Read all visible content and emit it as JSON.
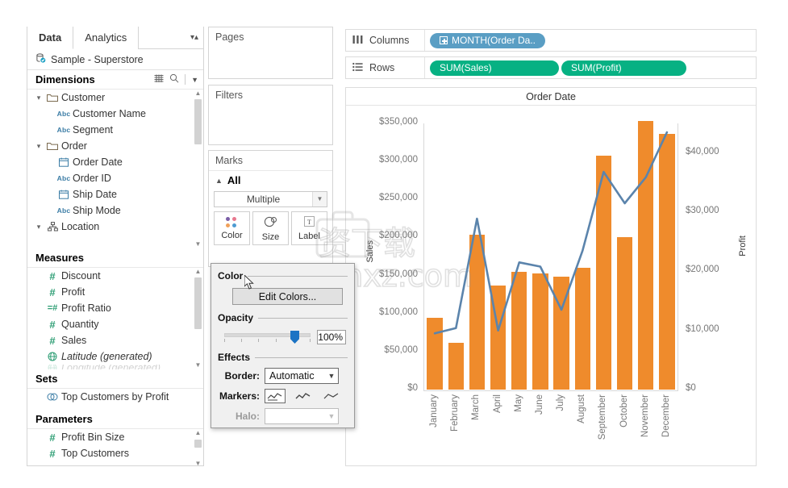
{
  "data_pane": {
    "tabs": [
      {
        "label": "Data",
        "active": true
      },
      {
        "label": "Analytics",
        "active": false
      }
    ],
    "tab_caret_icon": "updown-caret-icon",
    "datasource": {
      "name": "Sample - Superstore",
      "icon": "database-icon"
    },
    "dimensions": {
      "title": "Dimensions",
      "icons": [
        "grid-icon",
        "search-icon",
        "chevron-down-icon"
      ],
      "items": [
        {
          "label": "Customer",
          "type": "folder",
          "depth": 0,
          "expanded": true
        },
        {
          "label": "Customer Name",
          "type": "abc",
          "depth": 1
        },
        {
          "label": "Segment",
          "type": "abc",
          "depth": 1
        },
        {
          "label": "Order",
          "type": "folder",
          "depth": 0,
          "expanded": true
        },
        {
          "label": "Order Date",
          "type": "date",
          "depth": 1
        },
        {
          "label": "Order ID",
          "type": "abc",
          "depth": 1
        },
        {
          "label": "Ship Date",
          "type": "date",
          "depth": 1
        },
        {
          "label": "Ship Mode",
          "type": "abc",
          "depth": 1
        },
        {
          "label": "Location",
          "type": "hierarchy",
          "depth": 0,
          "expanded": true
        }
      ]
    },
    "measures": {
      "title": "Measures",
      "items": [
        {
          "label": "Discount",
          "type": "num"
        },
        {
          "label": "Profit",
          "type": "num"
        },
        {
          "label": "Profit Ratio",
          "type": "calc"
        },
        {
          "label": "Quantity",
          "type": "num"
        },
        {
          "label": "Sales",
          "type": "num"
        },
        {
          "label": "Latitude (generated)",
          "type": "geo",
          "italic": true
        }
      ]
    },
    "sets": {
      "title": "Sets",
      "items": [
        {
          "label": "Top Customers by Profit",
          "type": "set"
        }
      ]
    },
    "parameters": {
      "title": "Parameters",
      "items": [
        {
          "label": "Profit Bin Size",
          "type": "num"
        },
        {
          "label": "Top Customers",
          "type": "num"
        }
      ]
    }
  },
  "cards": {
    "pages": {
      "title": "Pages"
    },
    "filters": {
      "title": "Filters"
    },
    "marks": {
      "title": "Marks",
      "all_label": "All",
      "mark_type": "Multiple",
      "buttons": [
        {
          "label": "Color",
          "icon": "color-dots-icon"
        },
        {
          "label": "Size",
          "icon": "size-circles-icon"
        },
        {
          "label": "Label",
          "icon": "label-text-icon"
        }
      ]
    }
  },
  "color_popup": {
    "color_group_label": "Color",
    "edit_colors_label": "Edit Colors...",
    "opacity_group_label": "Opacity",
    "opacity_value": "100%",
    "effects_group_label": "Effects",
    "border_label": "Border:",
    "border_value": "Automatic",
    "markers_label": "Markers:",
    "halo_label": "Halo:",
    "halo_value": ""
  },
  "shelves": {
    "columns": {
      "label": "Columns",
      "icon": "columns-icon",
      "pills": [
        {
          "text": "MONTH(Order Da..",
          "color": "blue",
          "has_plus": true
        }
      ]
    },
    "rows": {
      "label": "Rows",
      "icon": "rows-icon",
      "pills": [
        {
          "text": "SUM(Sales)",
          "color": "green"
        },
        {
          "text": "SUM(Profit)",
          "color": "green"
        }
      ]
    }
  },
  "viz": {
    "title": "Order Date",
    "bar_color": "#ef8b2c",
    "line_color": "#5b84ac"
  },
  "watermark": {
    "text1": "资下载",
    "text2": "anxz.com"
  },
  "chart_data": {
    "type": "bar",
    "title": "Order Date",
    "xlabel": "",
    "categories": [
      "January",
      "February",
      "March",
      "April",
      "May",
      "June",
      "July",
      "August",
      "September",
      "October",
      "November",
      "December"
    ],
    "grid": false,
    "legend": "none",
    "series": [
      {
        "name": "SUM(Sales)",
        "type": "bar",
        "color": "#ef8b2c",
        "axis": "left",
        "ylabel": "Sales",
        "ylim": [
          0,
          350000
        ],
        "yticks": [
          0,
          50000,
          100000,
          150000,
          200000,
          250000,
          300000,
          350000
        ],
        "ytick_labels": [
          "$0",
          "$50,000",
          "$100,000",
          "$150,000",
          "$200,000",
          "$250,000",
          "$300,000",
          "$350,000"
        ],
        "values": [
          94000,
          62000,
          204000,
          137000,
          155000,
          153000,
          148000,
          160000,
          308000,
          200000,
          353000,
          336000
        ]
      },
      {
        "name": "SUM(Profit)",
        "type": "line",
        "color": "#5b84ac",
        "axis": "right",
        "ylabel": "Profit",
        "ylim": [
          0,
          45000
        ],
        "yticks": [
          0,
          10000,
          20000,
          30000,
          40000
        ],
        "ytick_labels": [
          "$0",
          "$10,000",
          "$20,000",
          "$30,000",
          "$40,000"
        ],
        "values": [
          9500,
          10400,
          28900,
          10000,
          21500,
          20800,
          13500,
          23500,
          36800,
          31500,
          35900,
          43500
        ]
      }
    ]
  }
}
